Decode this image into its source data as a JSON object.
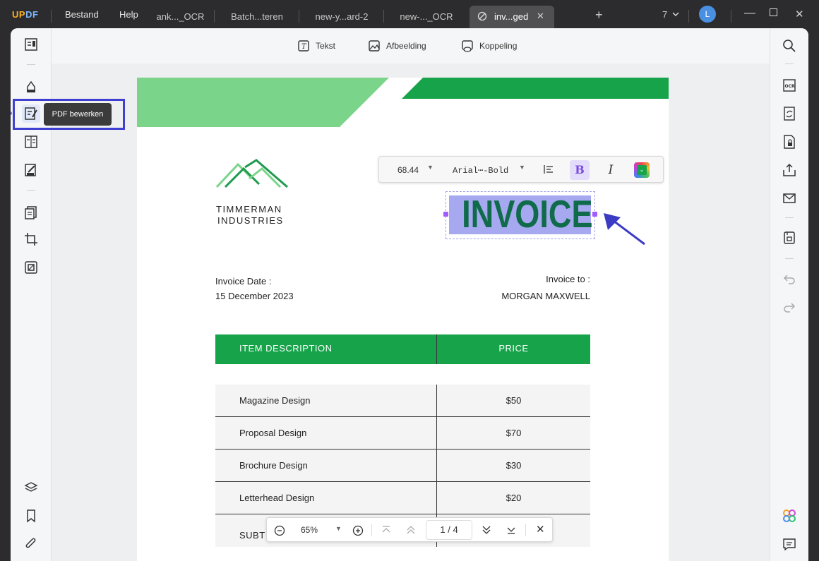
{
  "app": {
    "logo_u": "UP",
    "logo_pdf": "DF"
  },
  "menu": {
    "file": "Bestand",
    "help": "Help"
  },
  "tabs": [
    {
      "label": "ank..._OCR"
    },
    {
      "label": "Batch...teren"
    },
    {
      "label": "new-y...ard-2"
    },
    {
      "label": "new-..._OCR"
    },
    {
      "label": "inv...ged"
    }
  ],
  "window": {
    "tab_count": "7",
    "avatar_initial": "L"
  },
  "toolbar": {
    "text": "Tekst",
    "image": "Afbeelding",
    "link": "Koppeling"
  },
  "tooltip": {
    "label": "PDF bewerken"
  },
  "format": {
    "font_size": "68.44",
    "font_name": "Arial⋯-Bold",
    "bold": "B",
    "italic": "I"
  },
  "invoice": {
    "company_line1": "TIMMERMAN",
    "company_line2": "INDUSTRIES",
    "title": "INVOICE",
    "date_label": "Invoice Date :",
    "date_value": "15 December 2023",
    "to_label": "Invoice to :",
    "to_value": "MORGAN MAXWELL",
    "col_item": "ITEM DESCRIPTION",
    "col_price": "PRICE",
    "rows": [
      {
        "item": "Magazine Design",
        "price": "$50"
      },
      {
        "item": "Proposal Design",
        "price": "$70"
      },
      {
        "item": "Brochure Design",
        "price": "$30"
      },
      {
        "item": "Letterhead Design",
        "price": "$20"
      }
    ],
    "subtotal_label": "SUBT"
  },
  "zoom": {
    "level": "65%",
    "current_page": "1",
    "separator": "/",
    "total_pages": "4"
  },
  "colors": {
    "green_dark": "#16a34a",
    "green_light": "#7ad489",
    "logo_green": "#1f9a4f",
    "invoice_text": "#0f6b4a",
    "selection": "#a6a8f0",
    "highlight_box": "#3f3fd1",
    "arrow": "#3b3bc4"
  }
}
